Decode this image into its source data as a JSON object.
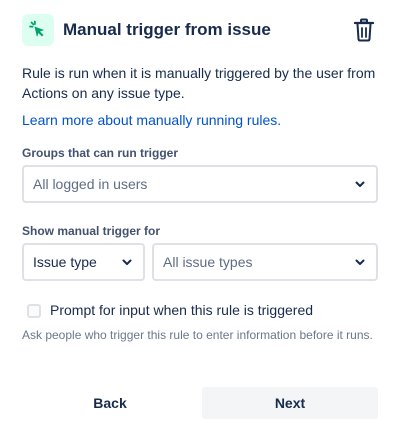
{
  "header": {
    "title": "Manual trigger from issue",
    "icon": "cursor-click-icon",
    "icon_color": "#00A36C",
    "icon_bg": "#DCFFF1"
  },
  "description": "Rule is run when it is manually triggered by the user from Actions on any issue type.",
  "learn_more_link": "Learn more about manually running rules.",
  "groups": {
    "label": "Groups that can run trigger",
    "placeholder": "All logged in users"
  },
  "show_for": {
    "label": "Show manual trigger for",
    "type_value": "Issue type",
    "types_placeholder": "All issue types"
  },
  "prompt": {
    "checkbox_label": "Prompt for input when this rule is triggered",
    "checked": false,
    "help_text": "Ask people who trigger this rule to enter information before it runs."
  },
  "actions": {
    "back_label": "Back",
    "next_label": "Next"
  },
  "colors": {
    "text": "#172B4D",
    "link": "#0052CC",
    "subtle": "#6B778C",
    "border": "#DFE1E6",
    "button_bg": "#F4F5F7"
  }
}
